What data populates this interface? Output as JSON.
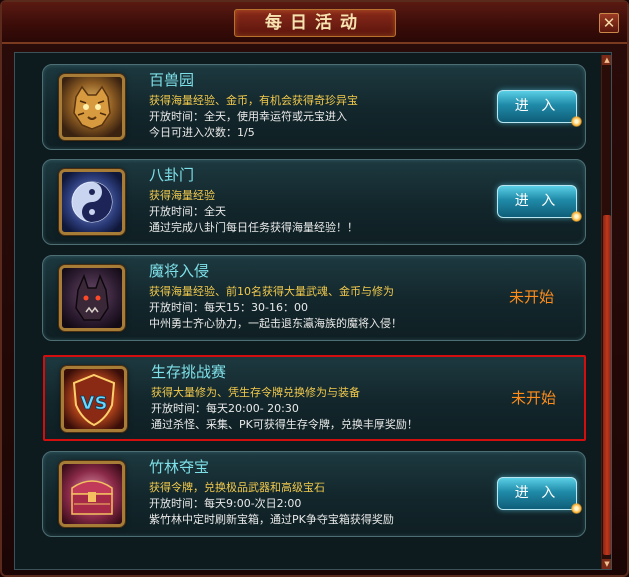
{
  "window": {
    "title": "每日活动",
    "close_label": "✕"
  },
  "activities": [
    {
      "name": "百兽园",
      "desc": "获得海量经验、金币，有机会获得奇珍异宝",
      "info1": "开放时间：全天，使用幸运符或元宝进入",
      "info2": "今日可进入次数：1/5",
      "action": "进 入",
      "icon": "tiger-icon"
    },
    {
      "name": "八卦门",
      "desc": "获得海量经验",
      "info1": "开放时间：全天",
      "info2": "通过完成八卦门每日任务获得海量经验！！",
      "action": "进 入",
      "icon": "yin-yang-icon"
    },
    {
      "name": "魔将入侵",
      "desc": "获得海量经验、前10名获得大量武魂、金币与修为",
      "info1": "开放时间：每天15：30-16：00",
      "info2": "中州勇士齐心协力，一起击退东瀛海族的魔将入侵！",
      "status": "未开始",
      "icon": "demon-beast-icon"
    },
    {
      "name": "生存挑战赛",
      "desc": "获得大量修为、凭生存令牌兑换修为与装备",
      "info1": "开放时间：每天20:00- 20:30",
      "info2": "通过杀怪、采集、PK可获得生存令牌，兑换丰厚奖励！",
      "status": "未开始",
      "icon": "vs-shield-icon"
    },
    {
      "name": "竹林夺宝",
      "desc": "获得令牌，兑换极品武器和高级宝石",
      "info1": "开放时间：每天9:00-次日2:00",
      "info2": "紫竹林中定时刷新宝箱，通过PK争夺宝箱获得奖励",
      "action": "进 入",
      "icon": "treasure-chest-icon"
    }
  ],
  "colors": {
    "highlight_border": "#d40e0e",
    "status": "#ff8c1a",
    "name": "#7ee0e8",
    "desc": "#f2c94c"
  },
  "scrollbar": {
    "up_icon": "▲",
    "down_icon": "▼"
  }
}
